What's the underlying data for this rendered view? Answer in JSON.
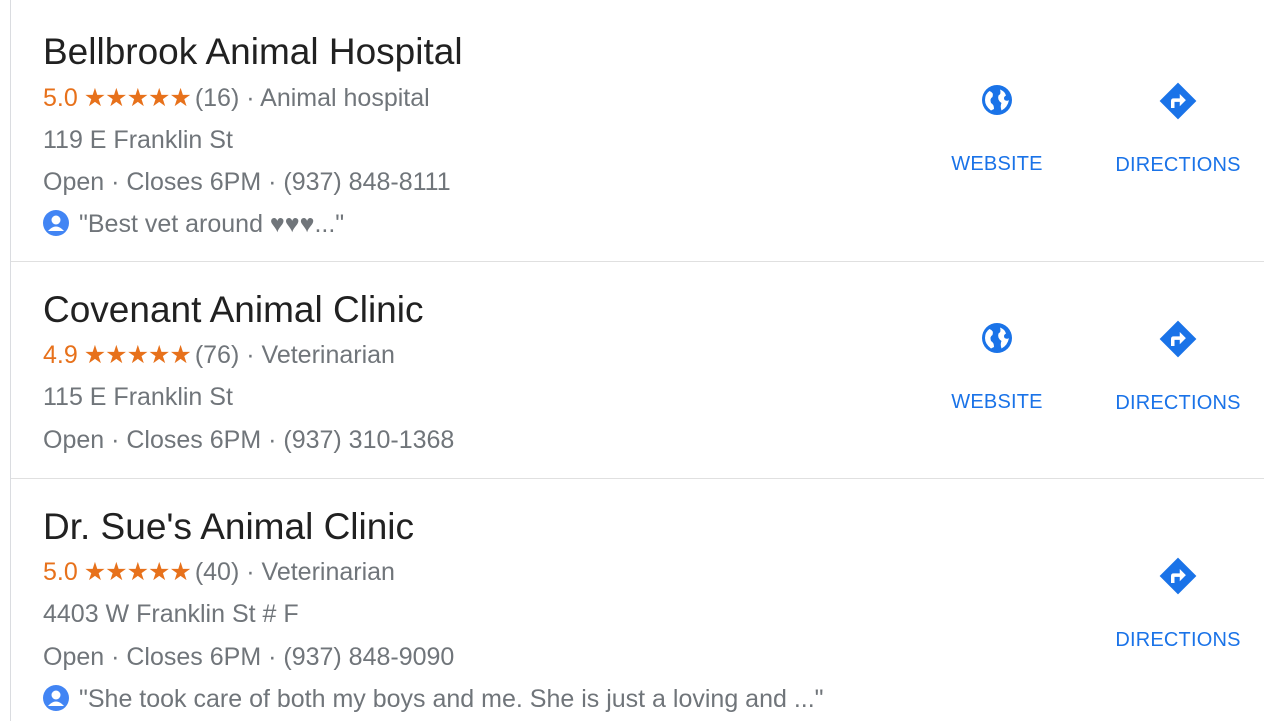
{
  "listings": [
    {
      "name": "Bellbrook Animal Hospital",
      "rating": "5.0",
      "stars": "★★★★★",
      "reviews": "(16)",
      "category": "Animal hospital",
      "address": "119 E Franklin St",
      "hours": "Open · Closes 6PM",
      "phone": "(937) 848-8111",
      "review_snippet": "\"Best vet around ♥♥♥...\"",
      "website_label": "WEBSITE",
      "directions_label": "DIRECTIONS"
    },
    {
      "name": "Covenant Animal Clinic",
      "rating": "4.9",
      "stars": "★★★★★",
      "reviews": "(76)",
      "category": "Veterinarian",
      "address": "115 E Franklin St",
      "hours": "Open · Closes 6PM",
      "phone": "(937) 310-1368",
      "website_label": "WEBSITE",
      "directions_label": "DIRECTIONS"
    },
    {
      "name": "Dr. Sue's Animal Clinic",
      "rating": "5.0",
      "stars": "★★★★★",
      "reviews": "(40)",
      "category": "Veterinarian",
      "address": "4403 W Franklin St # F",
      "hours": "Open · Closes 6PM",
      "phone": "(937) 848-9090",
      "review_snippet": "\"She took care of both my boys and me. She is just a loving and ...\"",
      "directions_label": "DIRECTIONS"
    }
  ],
  "separator": "·",
  "colors": {
    "rating": "#e7711b",
    "action_blue": "#1a73e8",
    "name": "#212121",
    "secondary": "#70757a"
  },
  "icons": {
    "website": "globe-icon",
    "directions": "directions-icon",
    "reviewer": "user-avatar-icon"
  }
}
